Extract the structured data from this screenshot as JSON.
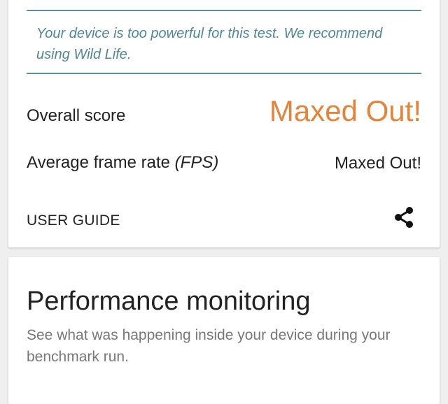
{
  "result_card": {
    "notice": "Your device is too powerful for this test. We recommend using Wild Life.",
    "overall_score_label": "Overall score",
    "overall_score_value": "Maxed Out!",
    "fps_label_main": "Average frame rate ",
    "fps_label_unit": "(FPS)",
    "fps_value": "Maxed Out!",
    "user_guide_label": "USER GUIDE",
    "share_icon": "share-icon"
  },
  "performance_card": {
    "title": "Performance monitoring",
    "description": "See what was happening inside your device during your benchmark run."
  },
  "colors": {
    "accent_teal": "#4f8794",
    "score_orange": "#e3843b"
  }
}
